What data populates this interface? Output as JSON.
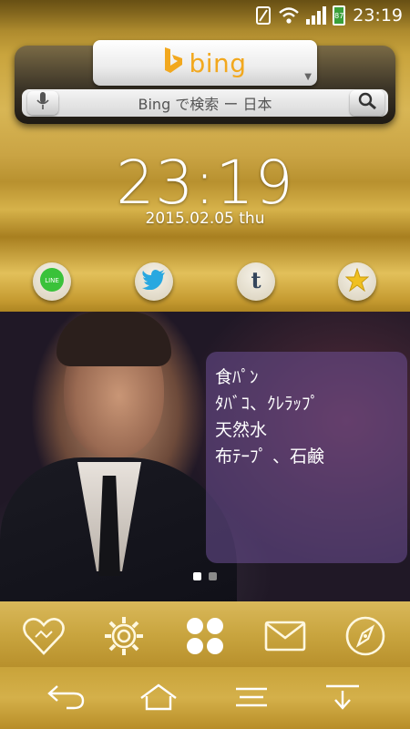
{
  "status_bar": {
    "battery_level": "87",
    "time": "23:19",
    "icons": [
      "sim-icon",
      "wifi-icon",
      "signal-icon",
      "battery-icon"
    ]
  },
  "bing": {
    "logo_text": "bing",
    "search_placeholder": "Bing で検索 ー 日本",
    "accent_color": "#f2a81e"
  },
  "clock": {
    "time": "23:19",
    "date": "2015.02.05 thu"
  },
  "social": {
    "items": [
      {
        "name": "line",
        "label": "LINE",
        "color": "#3ac23a"
      },
      {
        "name": "twitter",
        "color": "#29a8e0"
      },
      {
        "name": "tumblr",
        "label": "t",
        "color": "#35465c"
      },
      {
        "name": "favorites",
        "color": "#f0c020"
      }
    ]
  },
  "note": {
    "lines": [
      "食ﾊﾟﾝ",
      "ﾀﾊﾞｺ、ｸﾚﾗｯﾌﾟ",
      "天然水",
      "布ﾃｰﾌﾟ 、石鹸"
    ]
  },
  "pager": {
    "pages": 2,
    "current": 1
  },
  "dock": {
    "icons": [
      "heart-icon",
      "settings-gear-icon",
      "app-drawer-icon",
      "mail-icon",
      "compass-icon"
    ]
  },
  "nav": {
    "buttons": [
      "back-icon",
      "home-icon",
      "menu-icon",
      "recent-icon"
    ]
  }
}
